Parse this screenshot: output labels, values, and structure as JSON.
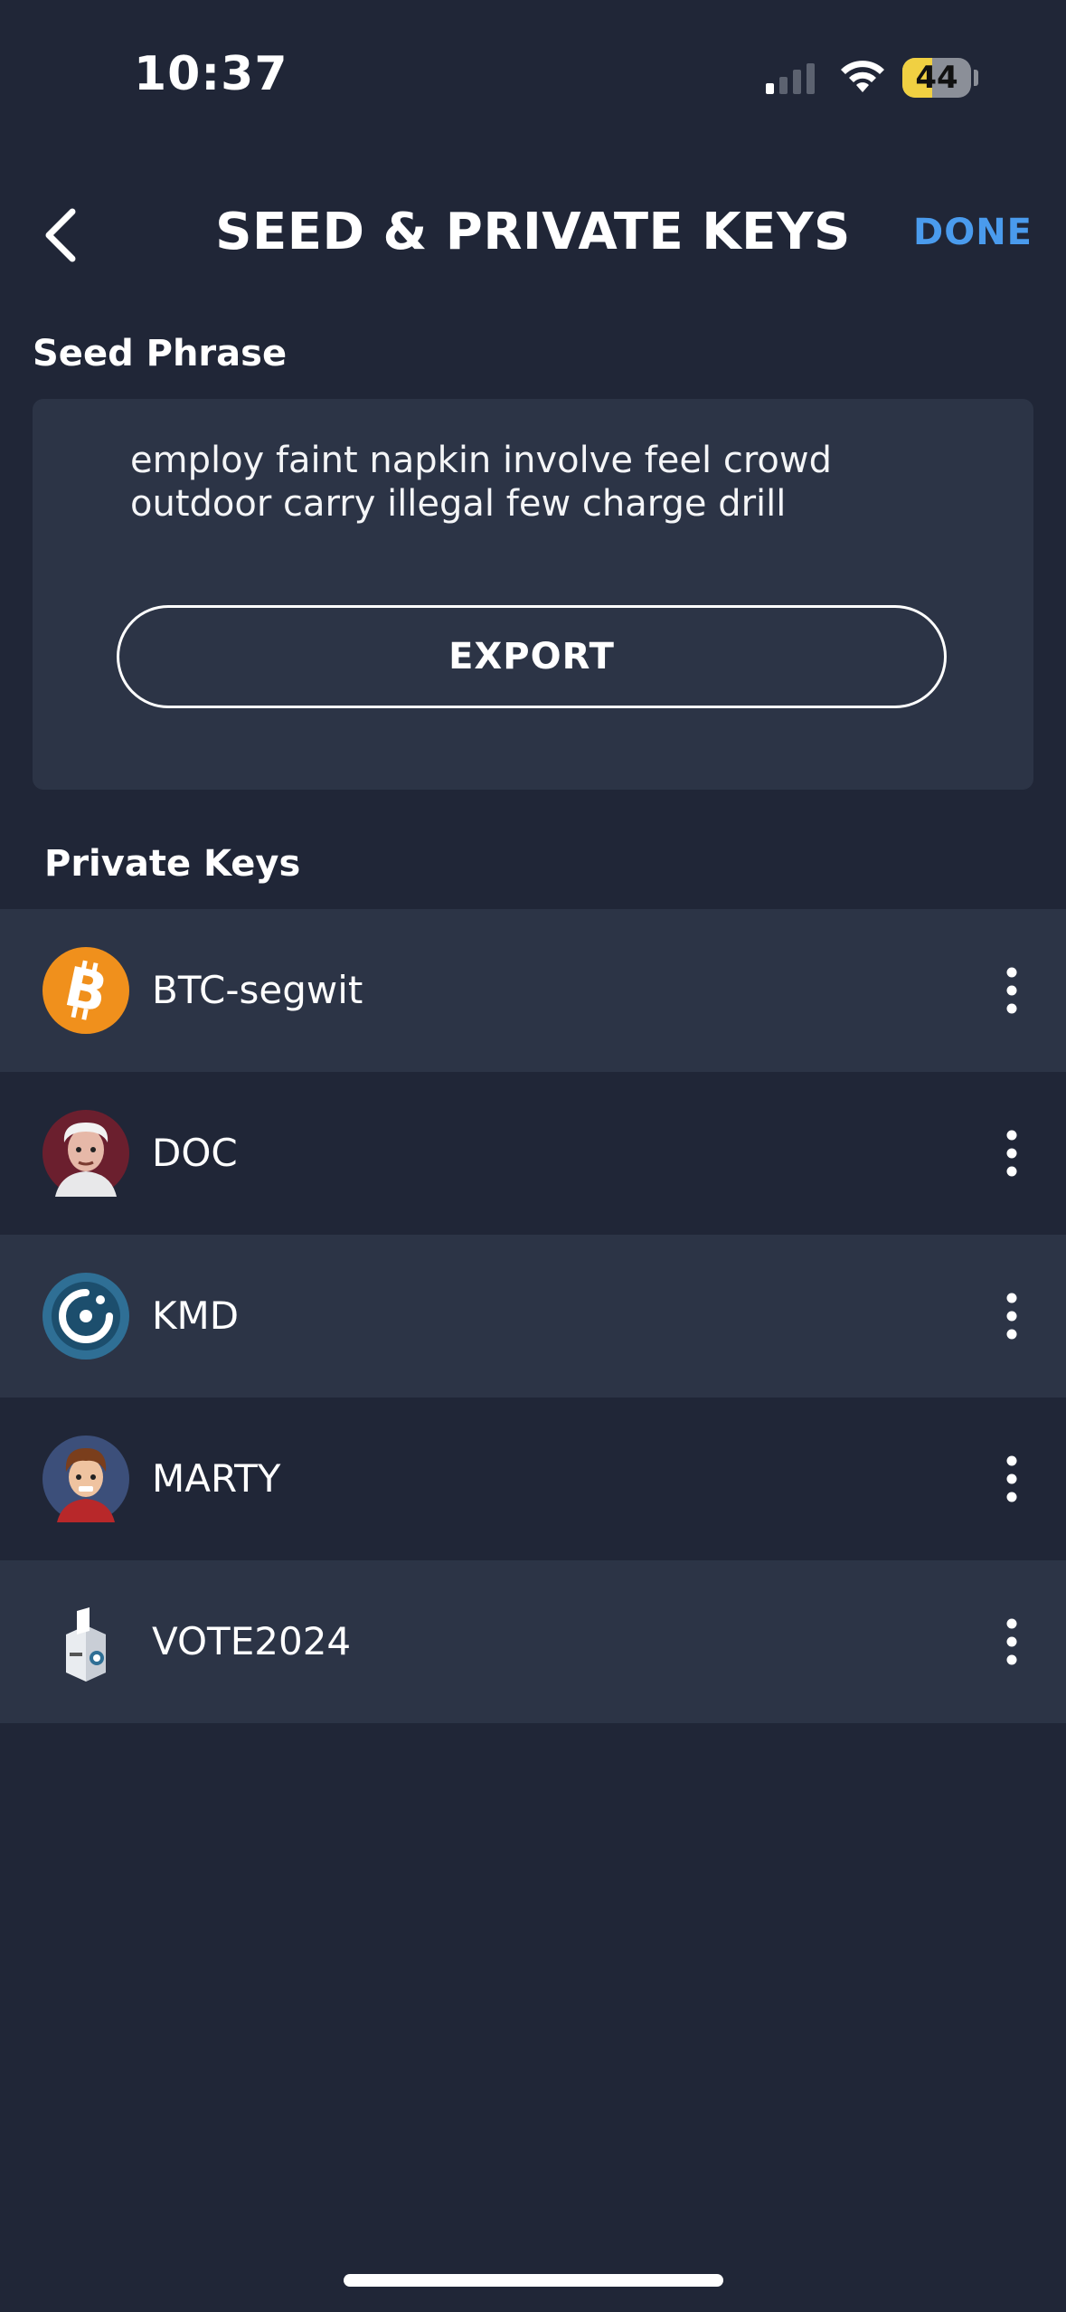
{
  "status_bar": {
    "time": "10:37",
    "battery": "44",
    "battery_level": 0.44
  },
  "header": {
    "title": "SEED & PRIVATE KEYS",
    "done_label": "DONE"
  },
  "seed": {
    "section_label": "Seed Phrase",
    "phrase_line1": "employ faint napkin involve feel crowd",
    "phrase_line2": "outdoor carry illegal few charge drill",
    "export_label": "EXPORT"
  },
  "keys": {
    "section_label": "Private Keys",
    "items": [
      {
        "name": "BTC-segwit",
        "icon": "bitcoin-icon"
      },
      {
        "name": "DOC",
        "icon": "doc-avatar-icon"
      },
      {
        "name": "KMD",
        "icon": "komodo-icon"
      },
      {
        "name": "MARTY",
        "icon": "marty-avatar-icon"
      },
      {
        "name": "VOTE2024",
        "icon": "ballot-box-icon"
      }
    ]
  },
  "colors": {
    "background": "#202637",
    "card": "#2c3446",
    "accent": "#4a9bed",
    "bitcoin": "#f0901c",
    "komodo": "#2f6f95",
    "battery": "#f0d042"
  }
}
